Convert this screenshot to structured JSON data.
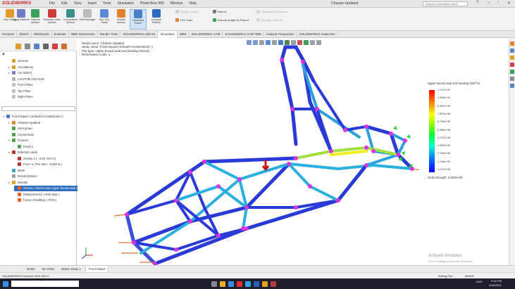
{
  "app": {
    "logo": "SOLIDWORKS",
    "menu": [
      "File",
      "Edit",
      "View",
      "Insert",
      "Tools",
      "Simulation",
      "PhotoView 360",
      "Window",
      "Help"
    ],
    "document_title": "Chassis-Updated",
    "search_placeholder": "Search Commands (Find)"
  },
  "toolbar": {
    "study_advisor": "New Study",
    "apply_material": "Apply Material",
    "fixtures_advisor": "Fixtures Advisor",
    "external_loads": "External Loads Advisor",
    "connections": "Connections Advisor",
    "shell_manager": "Shell Manager",
    "run_study": "Run This Study",
    "results_advisor": "Results Advisor",
    "deformed_result": "Deformed Result",
    "compare_results": "Compare Results",
    "design_insight": "Design Insight",
    "plot_tools": "Plot Tools",
    "report": "Report",
    "include_image": "Include Image for Report",
    "offload_simulation": "Offloaded Simulation",
    "manage_network": "Manage Network"
  },
  "tabs": [
    "Features",
    "Sketch",
    "Weldments",
    "Evaluate",
    "MBD Dimensions",
    "Render Tools",
    "SOLIDWORKS Add-Ins",
    "Simulation",
    "MBD",
    "SOLIDWORKS CAM",
    "SOLIDWORKS CAM TBM",
    "Analysis Preparation",
    "SOLIDWORKS Inspection"
  ],
  "active_tab": "Simulation",
  "tree": [
    {
      "label": "Sensors",
      "indent": 1,
      "caret": "",
      "color": "#e0a020"
    },
    {
      "label": "Annotations",
      "indent": 1,
      "caret": "▸",
      "color": "#d0a020"
    },
    {
      "label": "Cut list(97)",
      "indent": 1,
      "caret": "▸",
      "color": "#8080c0"
    },
    {
      "label": "CUSTOM AISI 4130",
      "indent": 1,
      "caret": "",
      "color": "#b0b0b0"
    },
    {
      "label": "Front Plane",
      "indent": 1,
      "caret": "",
      "color": "#c0c0c0"
    },
    {
      "label": "Top Plane",
      "indent": 1,
      "caret": "",
      "color": "#c0c0c0"
    },
    {
      "label": "Right Plane",
      "indent": 1,
      "caret": "",
      "color": "#c0c0c0"
    }
  ],
  "study_tree": [
    {
      "label": "Front Impact (-Default<As Machined>-)",
      "indent": 0,
      "caret": "▾",
      "color": "#4a7ad0",
      "selected": false
    },
    {
      "label": "Chassis-Updated",
      "indent": 1,
      "caret": "▸",
      "color": "#e08a30",
      "selected": false
    },
    {
      "label": "Joint group",
      "indent": 1,
      "caret": "",
      "color": "#50a050",
      "selected": false
    },
    {
      "label": "Connections",
      "indent": 1,
      "caret": "",
      "color": "#50a050",
      "selected": false
    },
    {
      "label": "Fixtures",
      "indent": 1,
      "caret": "▾",
      "color": "#50a050",
      "selected": false
    },
    {
      "label": "Fixed-1",
      "indent": 2,
      "caret": "",
      "color": "#50a050",
      "selected": false
    },
    {
      "label": "External Loads",
      "indent": 1,
      "caret": "▾",
      "color": "#c03030",
      "selected": false
    },
    {
      "label": "Gravity-1 (: -9.81 m/s^2:)",
      "indent": 2,
      "caret": "",
      "color": "#c03030",
      "selected": false
    },
    {
      "label": "Force-1 (:Per item: -8,000 N:)",
      "indent": 2,
      "caret": "",
      "color": "#c03030",
      "selected": false
    },
    {
      "label": "Mesh",
      "indent": 1,
      "caret": "",
      "color": "#40a0c0",
      "selected": false
    },
    {
      "label": "Result Options",
      "indent": 1,
      "caret": "",
      "color": "#a0a0a0",
      "selected": false
    },
    {
      "label": "Results",
      "indent": 1,
      "caret": "▾",
      "color": "#e0a020",
      "selected": false
    },
    {
      "label": "Stress1 (-Worst case Upper bound axial and bending-)",
      "indent": 2,
      "caret": "",
      "color": "#ff6020",
      "selected": true
    },
    {
      "label": "Displacement1 (-Res disp-)",
      "indent": 2,
      "caret": "",
      "color": "#ff6020",
      "selected": false
    },
    {
      "label": "Factor of Safety1 (-FOS-)",
      "indent": 2,
      "caret": "",
      "color": "#ff6020",
      "selected": false
    }
  ],
  "sim_info": {
    "model_name": "Model name: Chassis-Updated",
    "study_name": "Study name: Front Impact(-Default<As Machined>-)",
    "plot_type": "Plot type: Upper bound axial and bending Stress1",
    "deformation": "Deformation scale: 1"
  },
  "legend": {
    "title": "Upper bound axial and bending (N/m^2)",
    "ticks": [
      "1.117e+09",
      "1.006e+09",
      "8.940e+08",
      "7.823e+08",
      "6.706e+08",
      "5.588e+08",
      "4.471e+08",
      "3.353e+08",
      "2.236e+08",
      "1.118e+08",
      "1.072e+05"
    ],
    "yield_label": "Yield strength: 4.600e+08"
  },
  "watermark": {
    "title": "Activate Windows",
    "subtitle": "Go to Settings to activate Windows."
  },
  "bottom_tabs": [
    "Model",
    "3D Views",
    "Motion Study 1",
    "Front Impact"
  ],
  "active_bottom_tab": "Front Impact",
  "status": {
    "left": "SOLIDWORKS Premium 2019 SP0.0",
    "right_units": "MMGS",
    "editing": "Editing Part"
  },
  "taskbar": {
    "time": "9:42 PM",
    "date": "4/26/2021",
    "lang": "ENG"
  }
}
